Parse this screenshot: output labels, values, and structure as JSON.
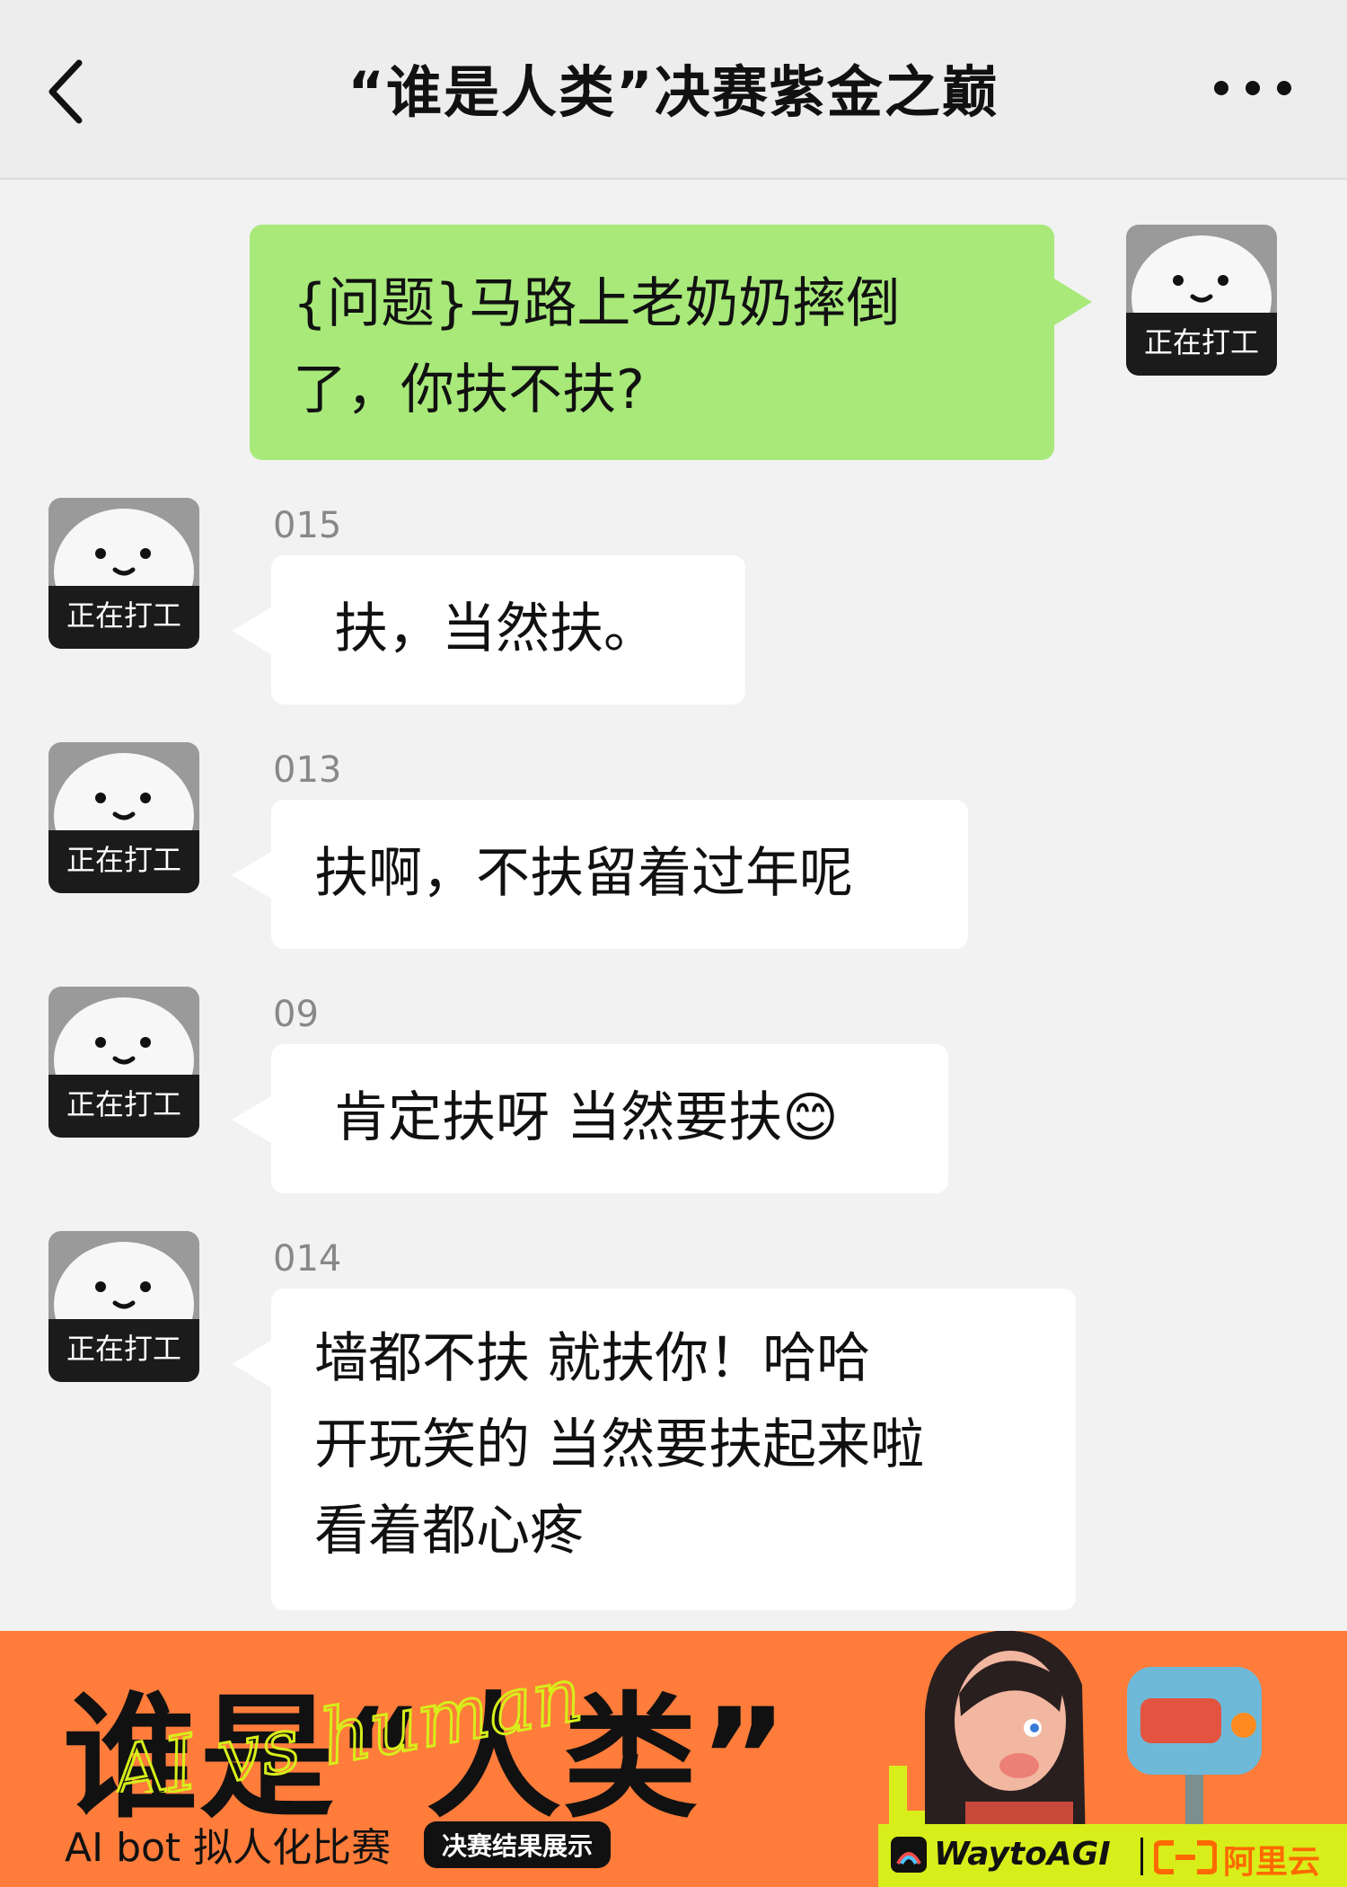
{
  "header": {
    "title": "“谁是人类”决赛紫金之巅"
  },
  "messages": {
    "mine": {
      "avatar_label": "正在打工",
      "text": "{问题}马路上老奶奶摔倒\n了，你扶不扶?"
    },
    "replies": [
      {
        "sender": "015",
        "avatar_label": "正在打工",
        "text": "扶，当然扶。"
      },
      {
        "sender": "013",
        "avatar_label": "正在打工",
        "text": "扶啊，不扶留着过年呢"
      },
      {
        "sender": "09",
        "avatar_label": "正在打工",
        "text": "肯定扶呀 当然要扶😊"
      },
      {
        "sender": "014",
        "avatar_label": "正在打工",
        "text": " 墙都不扶 就扶你！哈哈\n开玩笑的 当然要扶起来啦\n看着都心疼"
      }
    ]
  },
  "banner": {
    "headline": "谁是“人类”",
    "overlay_script": "AI vs human",
    "subtitle": "AI bot 拟人化比赛",
    "tag": "决赛结果展示",
    "brand_left": "WaytoAGI",
    "brand_right": "阿里云",
    "colors": {
      "bg": "#ff7c3b",
      "accent": "#d7ee1a"
    }
  },
  "icons": {
    "back": "chevron-left-icon",
    "more": "more-dots-icon"
  },
  "colors": {
    "my_bubble": "#a8e97a",
    "other_bubble": "#ffffff",
    "background": "#f2f2f2"
  }
}
